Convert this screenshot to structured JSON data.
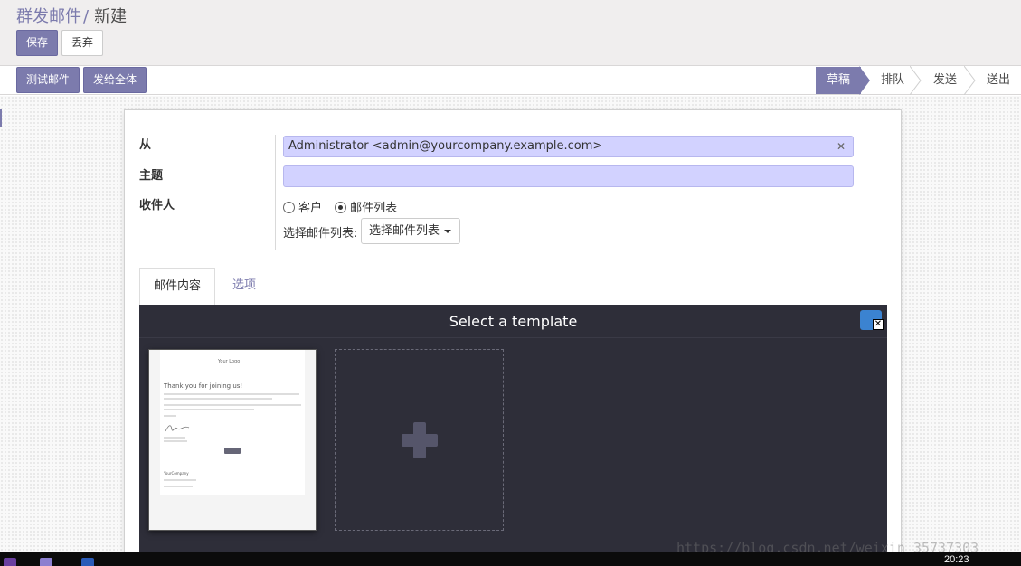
{
  "breadcrumb": {
    "parent": "群发邮件",
    "separator": "/",
    "current": "新建"
  },
  "buttons": {
    "save": "保存",
    "discard": "丢弃",
    "test_mail": "测试邮件",
    "send_all": "发给全体"
  },
  "stages": [
    "草稿",
    "排队",
    "发送",
    "送出"
  ],
  "active_stage": "草稿",
  "form": {
    "from_label": "从",
    "from_value": "Administrator <admin@yourcompany.example.com>",
    "subject_label": "主题",
    "subject_value": "",
    "recipients_label": "收件人",
    "recipient_options": [
      "客户",
      "邮件列表"
    ],
    "recipient_selected": "邮件列表",
    "mailing_list_label": "选择邮件列表:",
    "mailing_list_select": "选择邮件列表"
  },
  "tabs": [
    "邮件内容",
    "选项"
  ],
  "editor": {
    "title": "Select a template",
    "template_preview": {
      "logo_text": "Your Logo",
      "heading": "Thank you for joining us!",
      "footer_company": "YourCompany"
    }
  },
  "taskbar": {
    "time": "20:23"
  },
  "watermark": "https://blog.csdn.net/weixin_35737303",
  "colors": {
    "accent": "#7c7bad",
    "field_bg": "#d2d2ff",
    "editor_bg": "#2e2e39"
  }
}
